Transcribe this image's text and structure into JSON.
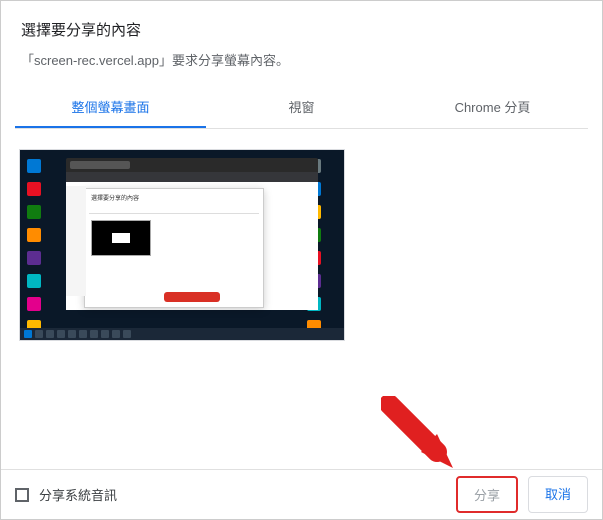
{
  "header": {
    "title": "選擇要分享的內容",
    "subtitle": "「screen-rec.vercel.app」要求分享螢幕內容。"
  },
  "tabs": {
    "entire_screen": "整個螢幕畫面",
    "window": "視窗",
    "chrome_tab": "Chrome 分頁"
  },
  "inner_dialog": {
    "title": "選擇要分享的內容"
  },
  "footer": {
    "checkbox_label": "分享系統音訊",
    "share": "分享",
    "cancel": "取消"
  }
}
